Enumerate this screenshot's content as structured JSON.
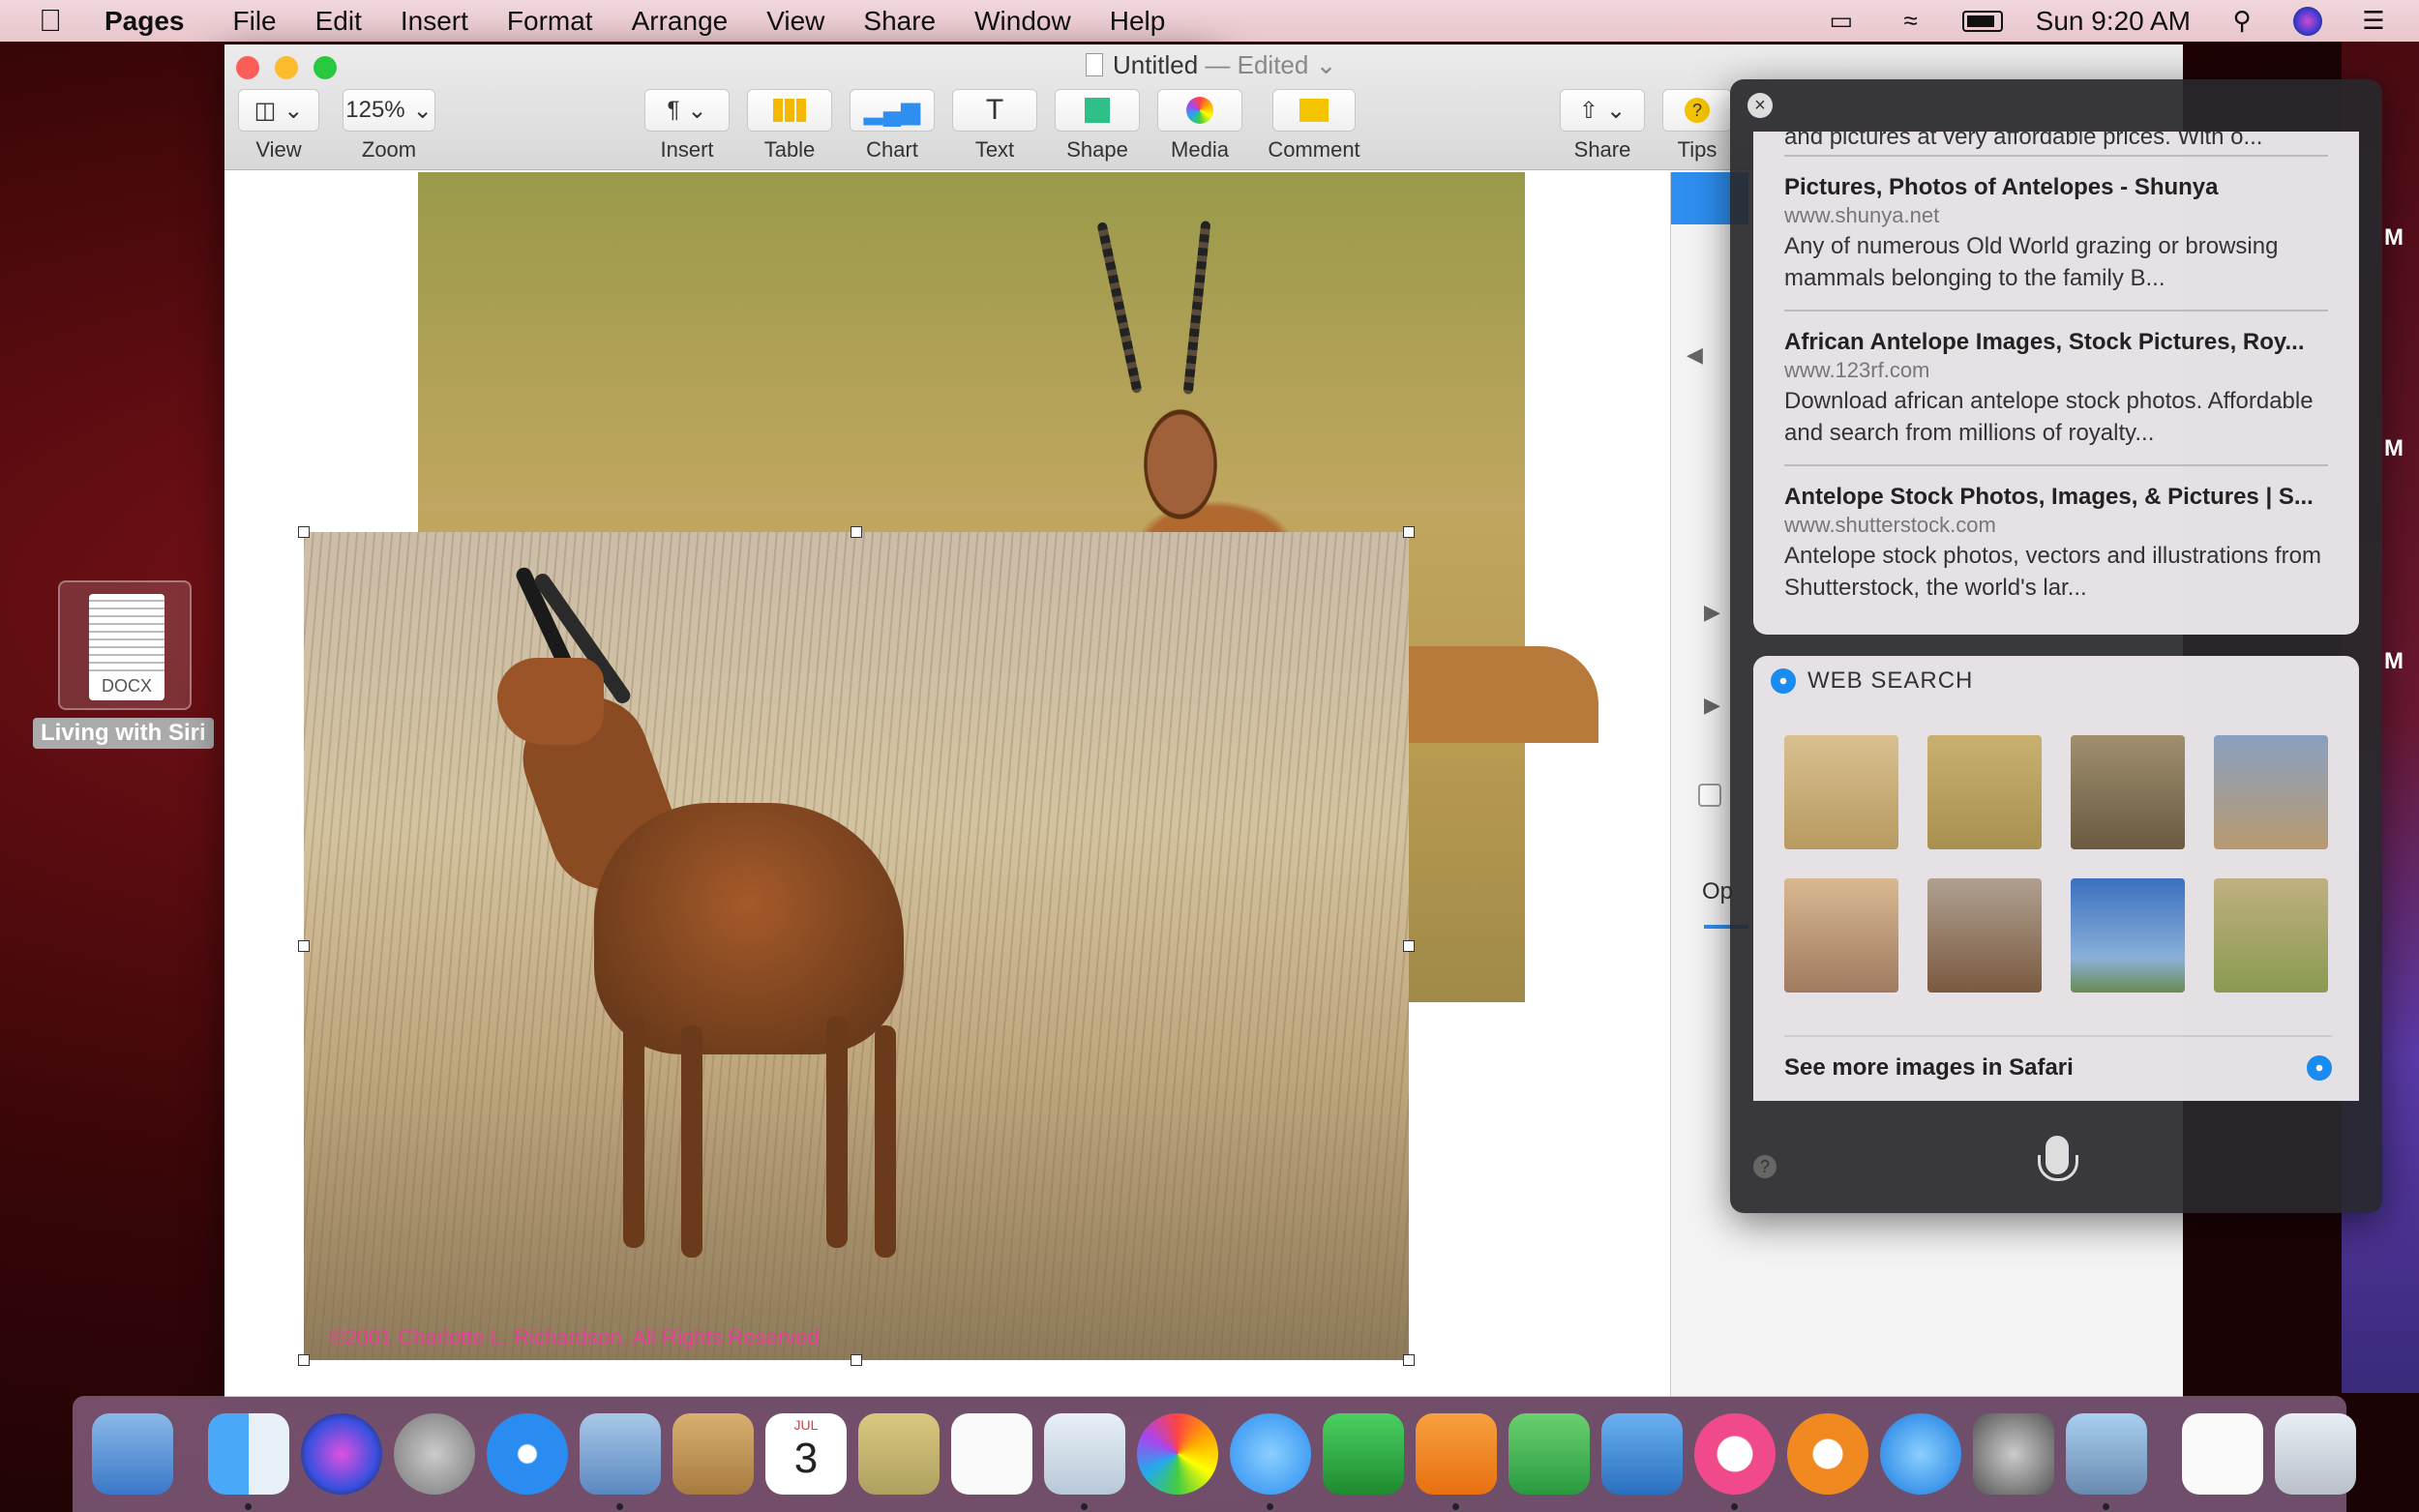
{
  "menubar": {
    "app_name": "Pages",
    "items": [
      "File",
      "Edit",
      "Insert",
      "Format",
      "Arrange",
      "View",
      "Share",
      "Window",
      "Help"
    ],
    "clock": "Sun 9:20 AM"
  },
  "desktop": {
    "file_label": "Living with Siri",
    "file_type": "DOCX"
  },
  "window": {
    "title": "Untitled",
    "status": "— Edited",
    "zoom_value": "125%",
    "toolbar": {
      "view": "View",
      "zoom": "Zoom",
      "insert": "Insert",
      "table": "Table",
      "chart": "Chart",
      "text": "Text",
      "shape": "Shape",
      "media": "Media",
      "comment": "Comment",
      "share": "Share",
      "tips": "Tips"
    },
    "photo_watermark": "©2001 Charlotte L. Richardson. All Rights Reserved",
    "inspector_label": "Op"
  },
  "siri": {
    "top_cutoff": "and pictures at very affordable prices. With o...",
    "results": [
      {
        "title": "Pictures, Photos of Antelopes - Shunya",
        "url": "www.shunya.net",
        "desc": "Any of numerous Old World grazing or browsing mammals belonging to the family B..."
      },
      {
        "title": "African Antelope Images, Stock Pictures, Roy...",
        "url": "www.123rf.com",
        "desc": "Download african antelope stock photos. Affordable and search from millions of royalty..."
      },
      {
        "title": "Antelope Stock Photos, Images, & Pictures | S...",
        "url": "www.shutterstock.com",
        "desc": "Antelope stock photos, vectors and illustrations from Shutterstock, the world's lar..."
      }
    ],
    "web_search_title": "WEB SEARCH",
    "see_more": "See more images in Safari",
    "side_letters": [
      "M",
      "M",
      "M"
    ]
  },
  "dock": {
    "calendar_month": "JUL",
    "calendar_day": "3"
  },
  "colors": {
    "inspector_accent": "#2e8ff0",
    "watermark": "#e8409a"
  }
}
